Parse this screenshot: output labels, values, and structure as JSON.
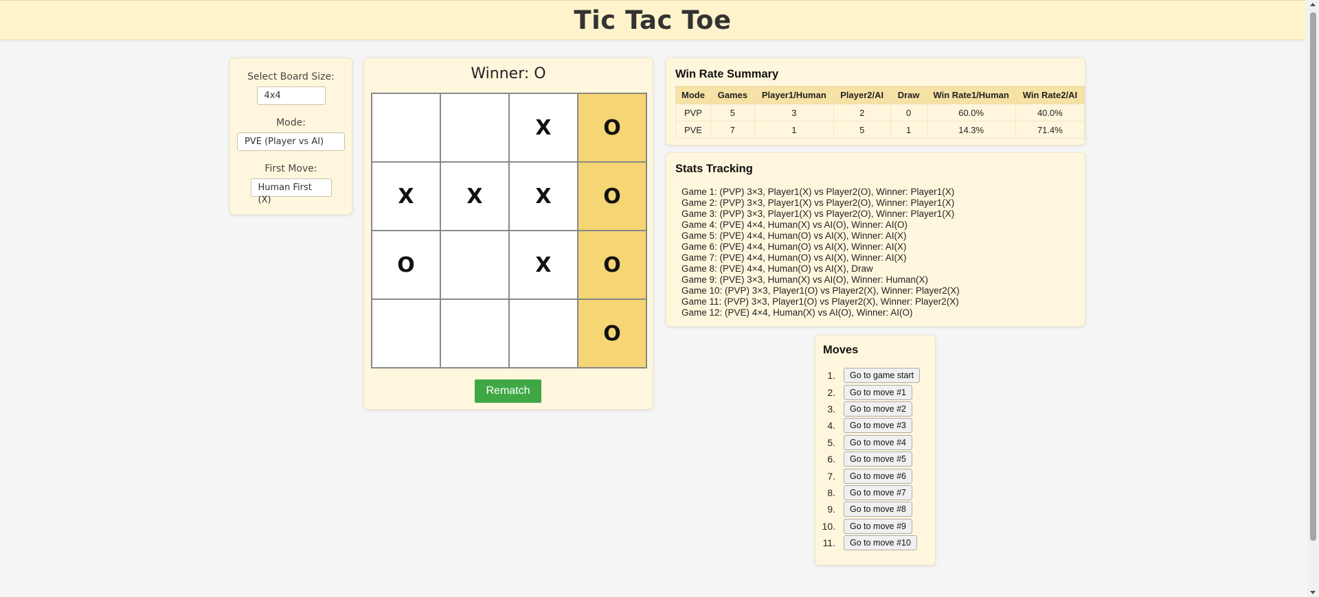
{
  "header": {
    "title": "Tic Tac Toe"
  },
  "settings": {
    "board_size_label": "Select Board Size:",
    "board_size_value": "4x4",
    "mode_label": "Mode:",
    "mode_value": "PVE (Player vs AI)",
    "first_move_label": "First Move:",
    "first_move_value": "Human First (X)"
  },
  "game": {
    "winner_text": "Winner: O",
    "board": [
      [
        "",
        "",
        "X",
        "O"
      ],
      [
        "X",
        "X",
        "X",
        "O"
      ],
      [
        "O",
        "",
        "X",
        "O"
      ],
      [
        "",
        "",
        "",
        "O"
      ]
    ],
    "winning_column": 3,
    "rematch_label": "Rematch"
  },
  "win_rate": {
    "title": "Win Rate Summary",
    "headers": [
      "Mode",
      "Games",
      "Player1/Human",
      "Player2/AI",
      "Draw",
      "Win Rate1/Human",
      "Win Rate2/AI"
    ],
    "rows": [
      [
        "PVP",
        "5",
        "3",
        "2",
        "0",
        "60.0%",
        "40.0%"
      ],
      [
        "PVE",
        "7",
        "1",
        "5",
        "1",
        "14.3%",
        "71.4%"
      ]
    ]
  },
  "stats": {
    "title": "Stats Tracking",
    "games": [
      "Game 1: (PVP) 3×3, Player1(X) vs Player2(O), Winner: Player1(X)",
      "Game 2: (PVP) 3×3, Player1(X) vs Player2(O), Winner: Player1(X)",
      "Game 3: (PVP) 3×3, Player1(X) vs Player2(O), Winner: Player1(X)",
      "Game 4: (PVE) 4×4, Human(X) vs AI(O), Winner: AI(O)",
      "Game 5: (PVE) 4×4, Human(O) vs AI(X), Winner: AI(X)",
      "Game 6: (PVE) 4×4, Human(O) vs AI(X), Winner: AI(X)",
      "Game 7: (PVE) 4×4, Human(O) vs AI(X), Winner: AI(X)",
      "Game 8: (PVE) 4×4, Human(O) vs AI(X), Draw",
      "Game 9: (PVE) 3×3, Human(X) vs AI(O), Winner: Human(X)",
      "Game 10: (PVP) 3×3, Player1(O) vs Player2(X), Winner: Player2(X)",
      "Game 11: (PVP) 3×3, Player1(O) vs Player2(X), Winner: Player2(X)",
      "Game 12: (PVE) 4×4, Human(X) vs AI(O), Winner: AI(O)"
    ]
  },
  "moves": {
    "title": "Moves",
    "items": [
      {
        "num": "1.",
        "label": "Go to game start"
      },
      {
        "num": "2.",
        "label": "Go to move #1"
      },
      {
        "num": "3.",
        "label": "Go to move #2"
      },
      {
        "num": "4.",
        "label": "Go to move #3"
      },
      {
        "num": "5.",
        "label": "Go to move #4"
      },
      {
        "num": "6.",
        "label": "Go to move #5"
      },
      {
        "num": "7.",
        "label": "Go to move #6"
      },
      {
        "num": "8.",
        "label": "Go to move #7"
      },
      {
        "num": "9.",
        "label": "Go to move #8"
      },
      {
        "num": "10.",
        "label": "Go to move #9"
      },
      {
        "num": "11.",
        "label": "Go to move #10"
      }
    ]
  },
  "colors": {
    "header_bg": "#fff3cc",
    "panel_bg": "#fff7dd",
    "win_cell": "#f5d574",
    "rematch_bg": "#3fa845",
    "table_header_bg": "#f7e2a6"
  }
}
